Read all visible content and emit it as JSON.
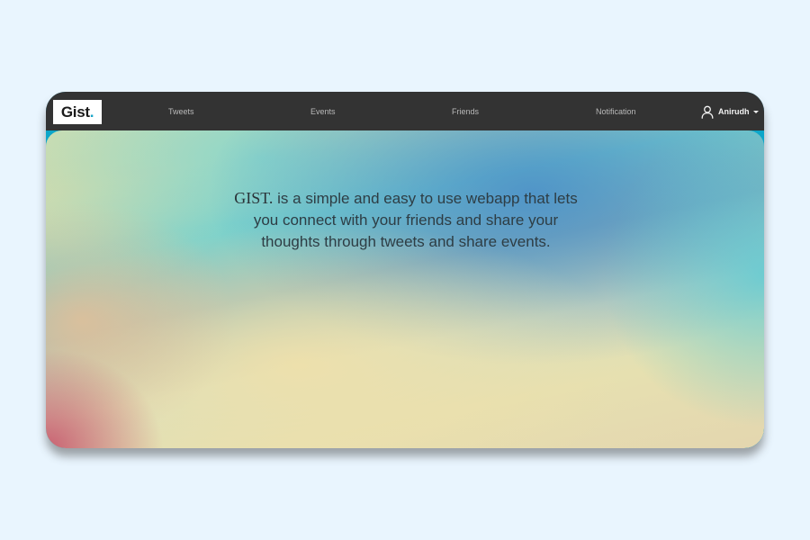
{
  "brand": {
    "logo_text": "Gist",
    "logo_dot": ".",
    "accent_color": "#1aa6c8"
  },
  "nav": {
    "items": [
      {
        "label": "Tweets"
      },
      {
        "label": "Events"
      },
      {
        "label": "Friends"
      },
      {
        "label": "Notification"
      }
    ]
  },
  "user": {
    "name": "Anirudh",
    "icon": "user-icon",
    "dropdown_icon": "caret-down-icon"
  },
  "hero": {
    "brand_word": "GIST.",
    "tagline": " is a simple and easy to use webapp that lets you connect with your friends and share your thoughts through tweets and share events."
  },
  "colors": {
    "page_background": "#e9f5fe",
    "navbar_background": "#333333",
    "nav_text": "#b9b9b9",
    "user_text": "#f2f2f2"
  }
}
